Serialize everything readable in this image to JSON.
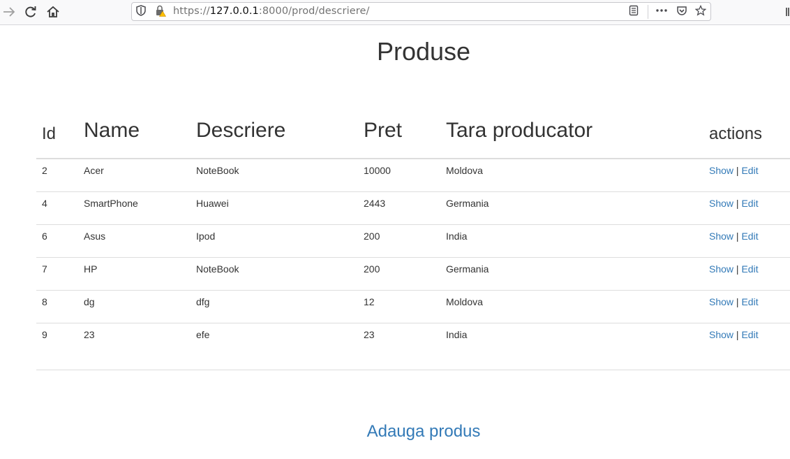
{
  "browser": {
    "url_prefix": "https://",
    "url_host": "127.0.0.1",
    "url_rest": ":8000/prod/descriere/"
  },
  "page": {
    "title": "Produse",
    "add_link": "Adauga produs"
  },
  "table": {
    "headers": [
      "Id",
      "Name",
      "Descriere",
      "Pret",
      "Tara producator",
      "actions"
    ],
    "rows": [
      {
        "id": "2",
        "name": "Acer",
        "descriere": "NoteBook",
        "pret": "10000",
        "tara": "Moldova"
      },
      {
        "id": "4",
        "name": "SmartPhone",
        "descriere": "Huawei",
        "pret": "2443",
        "tara": "Germania"
      },
      {
        "id": "6",
        "name": "Asus",
        "descriere": "Ipod",
        "pret": "200",
        "tara": "India"
      },
      {
        "id": "7",
        "name": "HP",
        "descriere": "NoteBook",
        "pret": "200",
        "tara": "Germania"
      },
      {
        "id": "8",
        "name": "dg",
        "descriere": "dfg",
        "pret": "12",
        "tara": "Moldova"
      },
      {
        "id": "9",
        "name": "23",
        "descriere": "efe",
        "pret": "23",
        "tara": "India"
      }
    ],
    "show_label": "Show",
    "separator": "|",
    "edit_label": "Edit"
  }
}
